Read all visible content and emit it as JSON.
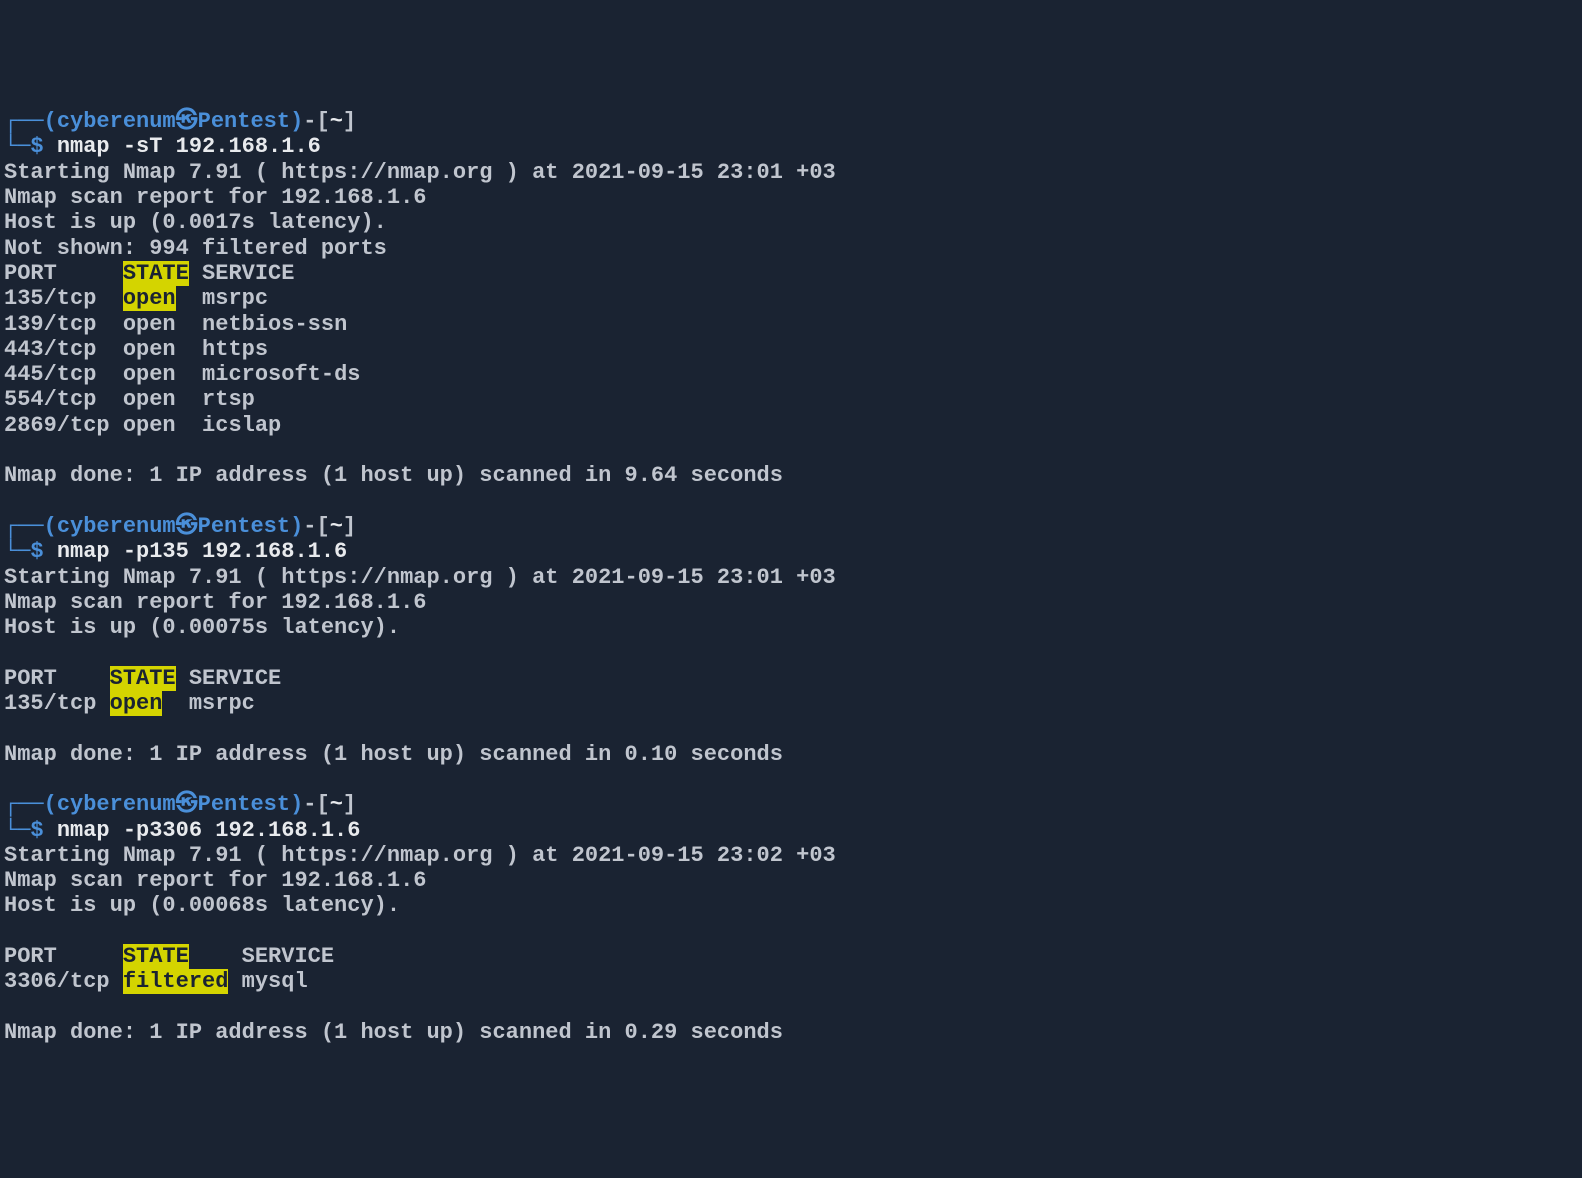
{
  "prompt": {
    "box_top": "┌──",
    "box_bottom": "└─",
    "paren_open": "(",
    "user": "cyberenum",
    "at": "㉿",
    "host": "Pentest",
    "paren_close": ")",
    "dash": "-",
    "bracket_open": "[",
    "cwd": "~",
    "bracket_close": "]",
    "dollar": "$"
  },
  "blocks": [
    {
      "command": "nmap -sT 192.168.1.6",
      "starting": "Starting Nmap 7.91 ( https://nmap.org ) at 2021-09-15 23:01 +03",
      "report": "Nmap scan report for 192.168.1.6",
      "hostup": "Host is up (0.0017s latency).",
      "notshown": "Not shown: 994 filtered ports",
      "header_port": "PORT     ",
      "header_state": "STATE",
      "header_service": " SERVICE",
      "rows": [
        {
          "port": "135/tcp  ",
          "state": "open",
          "state_hl": true,
          "service": "  msrpc"
        },
        {
          "port": "139/tcp  ",
          "state": "open",
          "state_hl": false,
          "service": "  netbios-ssn"
        },
        {
          "port": "443/tcp  ",
          "state": "open",
          "state_hl": false,
          "service": "  https"
        },
        {
          "port": "445/tcp  ",
          "state": "open",
          "state_hl": false,
          "service": "  microsoft-ds"
        },
        {
          "port": "554/tcp  ",
          "state": "open",
          "state_hl": false,
          "service": "  rtsp"
        },
        {
          "port": "2869/tcp ",
          "state": "open",
          "state_hl": false,
          "service": "  icslap"
        }
      ],
      "blank_before_done": true,
      "done": "Nmap done: 1 IP address (1 host up) scanned in 9.64 seconds"
    },
    {
      "command": "nmap -p135 192.168.1.6",
      "starting": "Starting Nmap 7.91 ( https://nmap.org ) at 2021-09-15 23:01 +03",
      "report": "Nmap scan report for 192.168.1.6",
      "hostup": "Host is up (0.00075s latency).",
      "notshown": "",
      "header_port": "PORT    ",
      "header_state": "STATE",
      "header_service": " SERVICE",
      "rows": [
        {
          "port": "135/tcp ",
          "state": "open",
          "state_hl": true,
          "service": "  msrpc"
        }
      ],
      "blank_before_done": true,
      "done": "Nmap done: 1 IP address (1 host up) scanned in 0.10 seconds"
    },
    {
      "command": "nmap -p3306 192.168.1.6",
      "starting": "Starting Nmap 7.91 ( https://nmap.org ) at 2021-09-15 23:02 +03",
      "report": "Nmap scan report for 192.168.1.6",
      "hostup": "Host is up (0.00068s latency).",
      "notshown": "",
      "header_port": "PORT     ",
      "header_state": "STATE",
      "header_service": "    SERVICE",
      "rows": [
        {
          "port": "3306/tcp ",
          "state": "filtered",
          "state_hl": true,
          "service": " mysql"
        }
      ],
      "blank_before_done": true,
      "done": "Nmap done: 1 IP address (1 host up) scanned in 0.29 seconds"
    }
  ]
}
